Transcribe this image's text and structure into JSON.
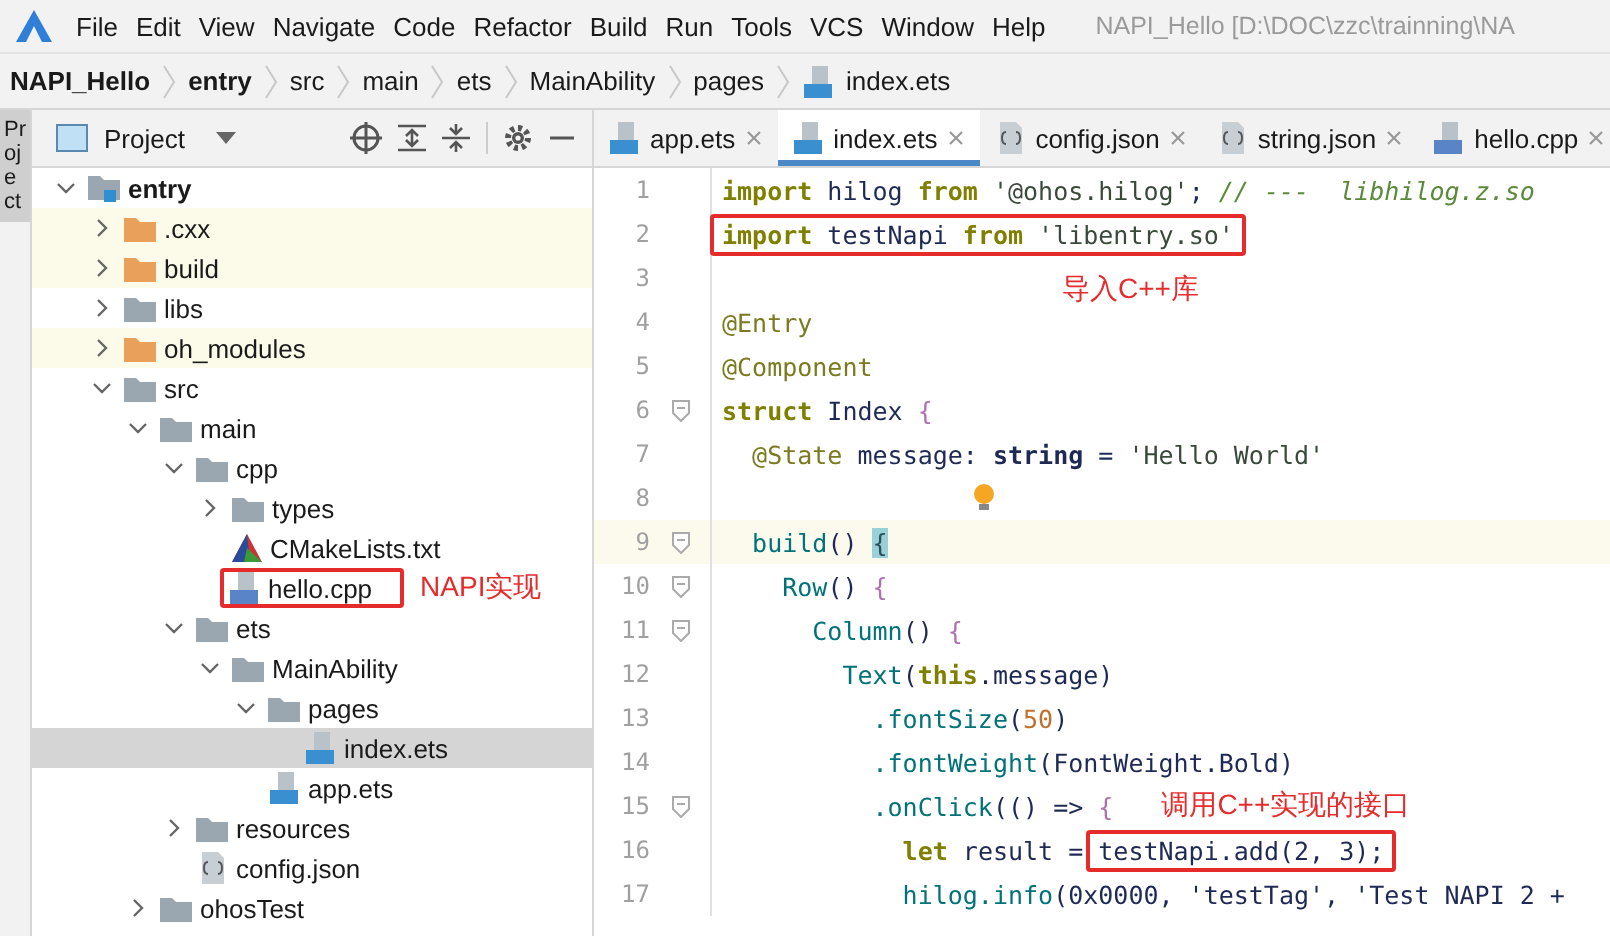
{
  "menu_bar": {
    "items": [
      "File",
      "Edit",
      "View",
      "Navigate",
      "Code",
      "Refactor",
      "Build",
      "Run",
      "Tools",
      "VCS",
      "Window",
      "Help"
    ],
    "title": "NAPI_Hello [D:\\DOC\\zzc\\trainning\\NA"
  },
  "breadcrumbs": [
    {
      "label": "NAPI_Hello",
      "kind": "project"
    },
    {
      "label": "entry",
      "kind": "project"
    },
    {
      "label": "src",
      "kind": "dir"
    },
    {
      "label": "main",
      "kind": "dir"
    },
    {
      "label": "ets",
      "kind": "dir"
    },
    {
      "label": "MainAbility",
      "kind": "dir"
    },
    {
      "label": "pages",
      "kind": "dir"
    },
    {
      "label": "index.ets",
      "kind": "file"
    }
  ],
  "side_stripe": {
    "label": "Project"
  },
  "project_panel": {
    "title": "Project",
    "tree": [
      {
        "label": "entry",
        "kind": "module",
        "expanded": true,
        "selected": false,
        "children": [
          {
            "label": ".cxx",
            "kind": "excluded",
            "expanded": false,
            "selected": false
          },
          {
            "label": "build",
            "kind": "excluded",
            "expanded": false,
            "selected": false
          },
          {
            "label": "libs",
            "kind": "folder",
            "expanded": false,
            "selected": false
          },
          {
            "label": "oh_modules",
            "kind": "excluded",
            "expanded": false,
            "selected": false
          },
          {
            "label": "src",
            "kind": "folder",
            "expanded": true,
            "selected": false,
            "children": [
              {
                "label": "main",
                "kind": "folder",
                "expanded": true,
                "selected": false,
                "children": [
                  {
                    "label": "cpp",
                    "kind": "folder",
                    "expanded": true,
                    "selected": false,
                    "children": [
                      {
                        "label": "types",
                        "kind": "folder",
                        "expanded": false,
                        "selected": false
                      },
                      {
                        "label": "CMakeLists.txt",
                        "kind": "cmake",
                        "selected": false
                      },
                      {
                        "label": "hello.cpp",
                        "kind": "cpp",
                        "selected": false,
                        "boxed": true,
                        "note": "NAPI实现"
                      }
                    ]
                  },
                  {
                    "label": "ets",
                    "kind": "folder",
                    "expanded": true,
                    "selected": false,
                    "children": [
                      {
                        "label": "MainAbility",
                        "kind": "folder",
                        "expanded": true,
                        "selected": false,
                        "children": [
                          {
                            "label": "pages",
                            "kind": "folder",
                            "expanded": true,
                            "selected": false,
                            "children": [
                              {
                                "label": "index.ets",
                                "kind": "ets",
                                "selected": true
                              }
                            ]
                          },
                          {
                            "label": "app.ets",
                            "kind": "ets",
                            "selected": false
                          }
                        ]
                      }
                    ]
                  },
                  {
                    "label": "resources",
                    "kind": "folder",
                    "expanded": false,
                    "selected": false
                  },
                  {
                    "label": "config.json",
                    "kind": "json",
                    "selected": false
                  }
                ]
              },
              {
                "label": "ohosTest",
                "kind": "folder",
                "expanded": false,
                "selected": false
              }
            ]
          }
        ]
      }
    ]
  },
  "editor": {
    "tabs": [
      {
        "label": "app.ets",
        "kind": "ets",
        "selected": false
      },
      {
        "label": "index.ets",
        "kind": "ets",
        "selected": true
      },
      {
        "label": "config.json",
        "kind": "json",
        "selected": false
      },
      {
        "label": "string.json",
        "kind": "json",
        "selected": false
      },
      {
        "label": "hello.cpp",
        "kind": "cpp",
        "selected": false
      }
    ],
    "lines": [
      {
        "number": "1",
        "tokens": [
          {
            "text": "import",
            "kind": "keyword"
          },
          {
            "text": " hilog ",
            "kind": "plain"
          },
          {
            "text": "from",
            "kind": "keyword"
          },
          {
            "text": " '@ohos.hilog'",
            "kind": "string"
          },
          {
            "text": "; ",
            "kind": "plain"
          },
          {
            "text": "// ---  ",
            "kind": "comment"
          },
          {
            "text": "libhilog.z.so",
            "kind": "comment"
          }
        ]
      },
      {
        "number": "2",
        "boxed": true,
        "tokens": [
          {
            "text": "import",
            "kind": "keyword"
          },
          {
            "text": " testNapi ",
            "kind": "plain"
          },
          {
            "text": "from",
            "kind": "keyword"
          },
          {
            "text": " 'libentry.so'",
            "kind": "string"
          }
        ]
      },
      {
        "number": "3",
        "note": "导入C++库"
      },
      {
        "number": "4",
        "tokens": [
          {
            "text": "@Entry",
            "kind": "annotation"
          }
        ]
      },
      {
        "number": "5",
        "tokens": [
          {
            "text": "@Component",
            "kind": "annotation"
          }
        ]
      },
      {
        "number": "6",
        "fold": true,
        "tokens": [
          {
            "text": "struct",
            "kind": "keyword"
          },
          {
            "text": " Index ",
            "kind": "plain"
          },
          {
            "text": "{",
            "kind": "brace"
          }
        ]
      },
      {
        "number": "7",
        "tokens": [
          {
            "text": "  @State",
            "kind": "annotation"
          },
          {
            "text": " message: ",
            "kind": "plain"
          },
          {
            "text": "string",
            "kind": "type"
          },
          {
            "text": " = ",
            "kind": "plain"
          },
          {
            "text": "'Hello World'",
            "kind": "string"
          }
        ]
      },
      {
        "number": "8",
        "bulb": true
      },
      {
        "number": "9",
        "fold": true,
        "current": true,
        "tokens": [
          {
            "text": "  build",
            "kind": "func"
          },
          {
            "text": "() ",
            "kind": "plain"
          },
          {
            "text": "{",
            "kind": "match"
          }
        ]
      },
      {
        "number": "10",
        "fold": true,
        "tokens": [
          {
            "text": "    Row",
            "kind": "func"
          },
          {
            "text": "() ",
            "kind": "plain"
          },
          {
            "text": "{",
            "kind": "brace"
          }
        ]
      },
      {
        "number": "11",
        "fold": true,
        "tokens": [
          {
            "text": "      Column",
            "kind": "func"
          },
          {
            "text": "() ",
            "kind": "plain"
          },
          {
            "text": "{",
            "kind": "brace"
          }
        ]
      },
      {
        "number": "12",
        "tokens": [
          {
            "text": "        Text",
            "kind": "func"
          },
          {
            "text": "(",
            "kind": "plain"
          },
          {
            "text": "this",
            "kind": "keyword"
          },
          {
            "text": ".message)",
            "kind": "plain"
          }
        ]
      },
      {
        "number": "13",
        "tokens": [
          {
            "text": "          .fontSize",
            "kind": "func"
          },
          {
            "text": "(",
            "kind": "plain"
          },
          {
            "text": "50",
            "kind": "number"
          },
          {
            "text": ")",
            "kind": "plain"
          }
        ]
      },
      {
        "number": "14",
        "tokens": [
          {
            "text": "          .fontWeight",
            "kind": "func"
          },
          {
            "text": "(FontWeight.Bold)",
            "kind": "plain"
          }
        ]
      },
      {
        "number": "15",
        "fold": true,
        "note": "调用C++实现的接口",
        "tokens": [
          {
            "text": "          .onClick",
            "kind": "func"
          },
          {
            "text": "(() => ",
            "kind": "plain"
          },
          {
            "text": "{",
            "kind": "brace"
          }
        ]
      },
      {
        "number": "16",
        "tokens": [
          {
            "text": "            let",
            "kind": "keyword"
          },
          {
            "text": " result = ",
            "kind": "plain"
          },
          {
            "text": "testNapi.add(2, 3);",
            "kind": "plain",
            "boxed": true
          }
        ]
      },
      {
        "number": "17",
        "tokens": [
          {
            "text": "            hilog.info",
            "kind": "func"
          },
          {
            "text": "(0x0000, 'testTag', 'Test NAPI 2 +",
            "kind": "plain"
          }
        ]
      }
    ]
  }
}
